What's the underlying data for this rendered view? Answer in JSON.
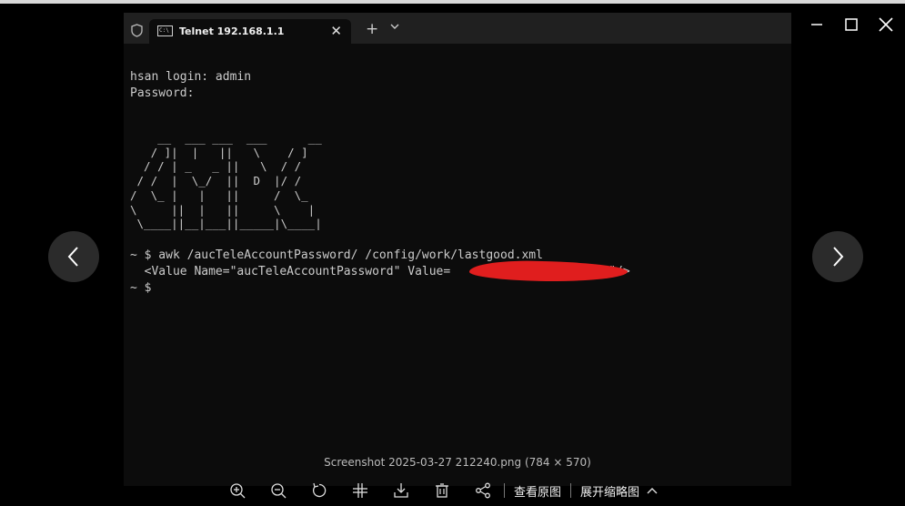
{
  "terminal": {
    "tab_title": "Telnet 192.168.1.1",
    "login_line": "hsan login: admin",
    "password_line": "Password:",
    "ascii_art": "    __  ___ ___  ___      __\n   / ]|  |   ||   \\    / ]\n  / / | _   _ ||   \\  / /\n / /  |  \\_/  ||  D  |/ /\n/  \\_ |   |   ||     /  \\_\n\\     ||  |   ||     \\    |\n \\____||__|___||_____|\\____|",
    "command_line": "~ $ awk /aucTeleAccountPassword/ /config/work/lastgood.xml",
    "output_prefix": "  <Value Name=\"aucTeleAccountPassword\" Value=",
    "output_suffix": "\"/>",
    "prompt_line": "~ $"
  },
  "viewer": {
    "caption": "Screenshot 2025-03-27 212240.png (784 × 570)",
    "toolbar": {
      "view_original": "查看原图",
      "expand_thumbnails": "展开缩略图"
    }
  },
  "icons": {
    "window": [
      "minimize-icon",
      "maximize-icon",
      "close-icon"
    ],
    "navigation": [
      "chevron-left-icon",
      "chevron-right-icon"
    ],
    "toolbar": [
      "zoom-in-icon",
      "zoom-out-icon",
      "rotate-icon",
      "fit-icon",
      "download-icon",
      "delete-icon",
      "share-icon",
      "chevron-up-icon"
    ]
  },
  "colors": {
    "terminal_bg": "#0c0c0c",
    "tabbar_bg": "#202020",
    "redaction": "#e01e1e",
    "viewer_bg": "#000000"
  }
}
